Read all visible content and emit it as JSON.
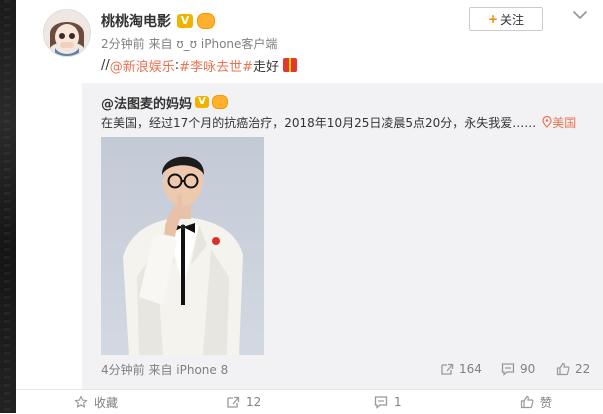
{
  "post": {
    "author_name": "桃桃淘电影",
    "meta": "2分钟前 来自 ʊ_ʊ iPhone客户端",
    "follow_label": "关注",
    "text_prefix": "//",
    "mention": "@新浪娱乐",
    "colon": ":",
    "hashtag": "#李咏去世#",
    "text_suffix": " 走好"
  },
  "repost": {
    "author_mention": "@法图麦的妈妈",
    "text": "在美国，经过17个月的抗癌治疗，2018年10月25日凌晨5点20分，永失我爱……",
    "location": "美国",
    "meta": "4分钟前 来自 iPhone 8",
    "reposts": "164",
    "comments": "90",
    "likes": "22"
  },
  "actions": {
    "favorite": "收藏",
    "repost_count": "12",
    "comment_count": "1",
    "like": "赞"
  },
  "colors": {
    "accent_orange": "#eb7350",
    "follow_plus": "#ff8200",
    "vip_badge": "#f2b300",
    "repost_bg": "#f2f2f5"
  },
  "icons": [
    "close-icon",
    "chevron-down-icon",
    "location-pin-icon",
    "repost-icon",
    "comment-icon",
    "like-icon",
    "star-icon",
    "gift-icon",
    "verified-badge-icon",
    "fan-badge-icon"
  ]
}
